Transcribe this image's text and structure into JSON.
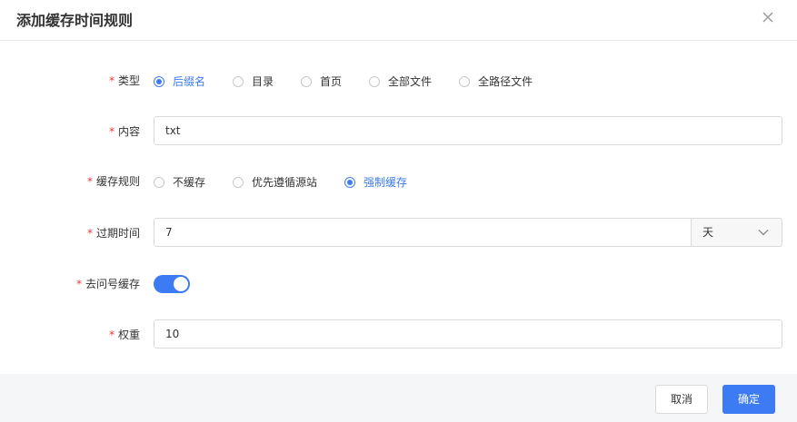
{
  "dialog": {
    "title": "添加缓存时间规则"
  },
  "form": {
    "type": {
      "label": "类型",
      "options": [
        "后缀名",
        "目录",
        "首页",
        "全部文件",
        "全路径文件"
      ],
      "selected_index": 0
    },
    "content": {
      "label": "内容",
      "value": "txt"
    },
    "cache_rule": {
      "label": "缓存规则",
      "options": [
        "不缓存",
        "优先遵循源站",
        "强制缓存"
      ],
      "selected_index": 2
    },
    "expire": {
      "label": "过期时间",
      "value": "7",
      "unit": "天"
    },
    "ignore_query": {
      "label": "去问号缓存",
      "enabled": true
    },
    "weight": {
      "label": "权重",
      "value": "10"
    },
    "required_mark": "*"
  },
  "footer": {
    "cancel_label": "取消",
    "ok_label": "确定"
  },
  "colors": {
    "accent": "#3d7bf5",
    "required": "#e23b3b"
  },
  "icons": {
    "close": "close-icon",
    "dropdown": "chevron-down-icon"
  }
}
